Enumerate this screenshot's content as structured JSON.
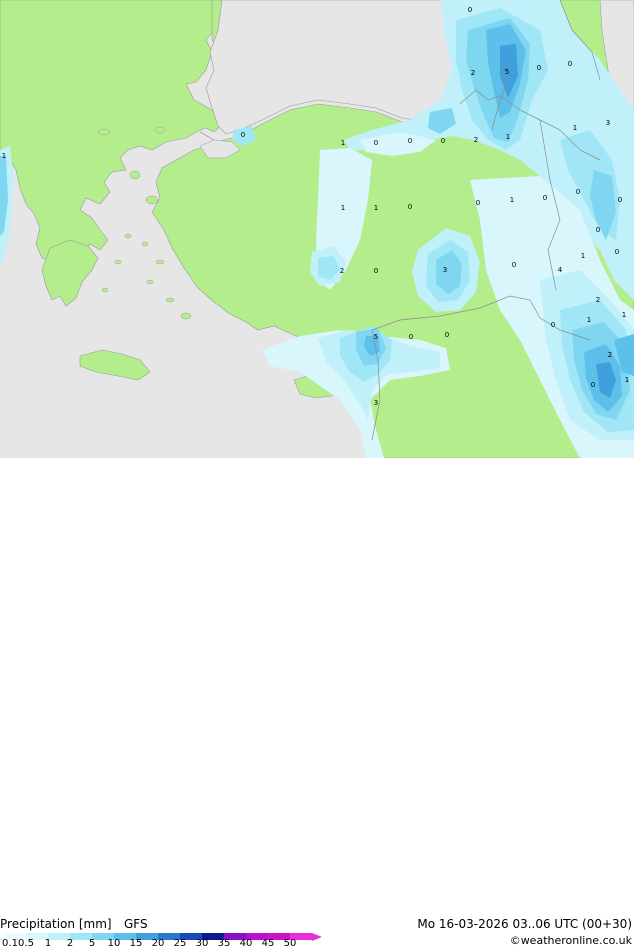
{
  "product": "Precipitation [mm]",
  "model": "GFS",
  "valid_time": "Mo 16-03-2026 03..06 UTC (00+30)",
  "credit": "©weatheronline.co.uk",
  "legend": {
    "ticks": [
      "0.1",
      "0.5",
      "1",
      "2",
      "5",
      "10",
      "15",
      "20",
      "25",
      "30",
      "35",
      "40",
      "45",
      "50"
    ],
    "colors": [
      "#f0fbff",
      "#d8f6fc",
      "#c0f0fa",
      "#a0e6f6",
      "#7ed6f0",
      "#5cc0ea",
      "#3ea0dc",
      "#2878cc",
      "#1a4ab8",
      "#101890",
      "#8a10c8",
      "#b810d0",
      "#d010c8",
      "#e830d8"
    ]
  },
  "map": {
    "colors": {
      "sea": "#e6e6e6",
      "land": "#b4ee8c",
      "border": "#8c8c8c",
      "coast": "#9a9a9a"
    },
    "contour_labels": [
      "0",
      "2",
      "5",
      "0",
      "0",
      "0",
      "1",
      "1",
      "0",
      "0",
      "0",
      "2",
      "1",
      "1",
      "3",
      "1",
      "1",
      "0",
      "0",
      "1",
      "0",
      "0",
      "0",
      "0",
      "1",
      "2",
      "0",
      "3",
      "0",
      "0",
      "1",
      "1",
      "0",
      "5",
      "0",
      "0",
      "1",
      "3",
      "2",
      "2",
      "4",
      "0"
    ]
  }
}
